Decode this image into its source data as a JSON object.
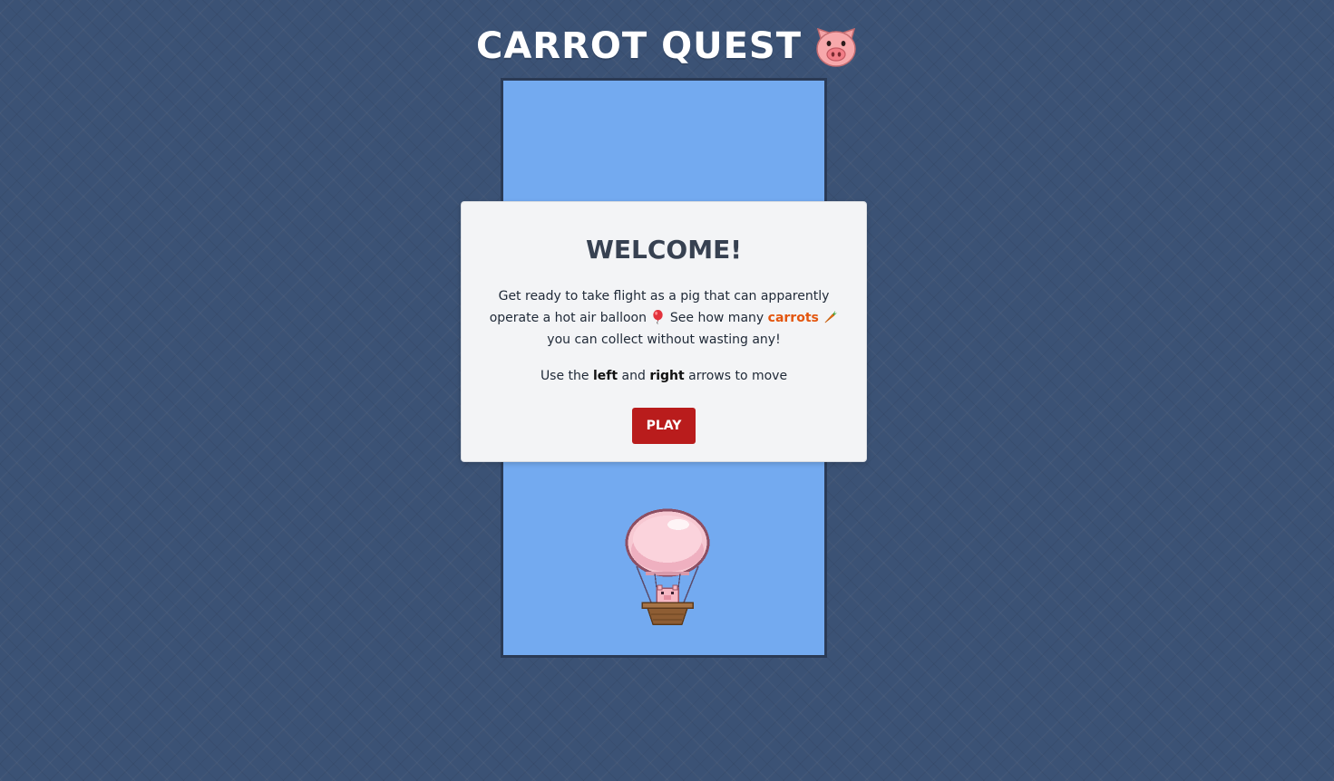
{
  "game": {
    "title": "CARROT QUEST"
  },
  "modal": {
    "heading": "WELCOME!",
    "intro_part1": "Get ready to take flight as a pig that can apparently operate a hot air balloon",
    "intro_part2": "See how many",
    "intro_carrots": "carrots",
    "intro_part3": "you can collect without wasting any!",
    "instructions_prefix": "Use the",
    "instructions_left": "left",
    "instructions_and": "and",
    "instructions_right": "right",
    "instructions_suffix": "arrows to move",
    "play_label": "PLAY"
  },
  "icons": {
    "title_icon": "pig-face-icon",
    "balloon_icon": "balloon-icon",
    "carrot_icon": "carrot-icon",
    "player_sprite": "pig-hot-air-balloon-sprite"
  },
  "colors": {
    "page_background": "#3b5275",
    "sky": "#73aaf0",
    "play_button": "#b91c1c",
    "carrots_highlight": "#e3560f",
    "modal_background": "#f3f4f6"
  }
}
